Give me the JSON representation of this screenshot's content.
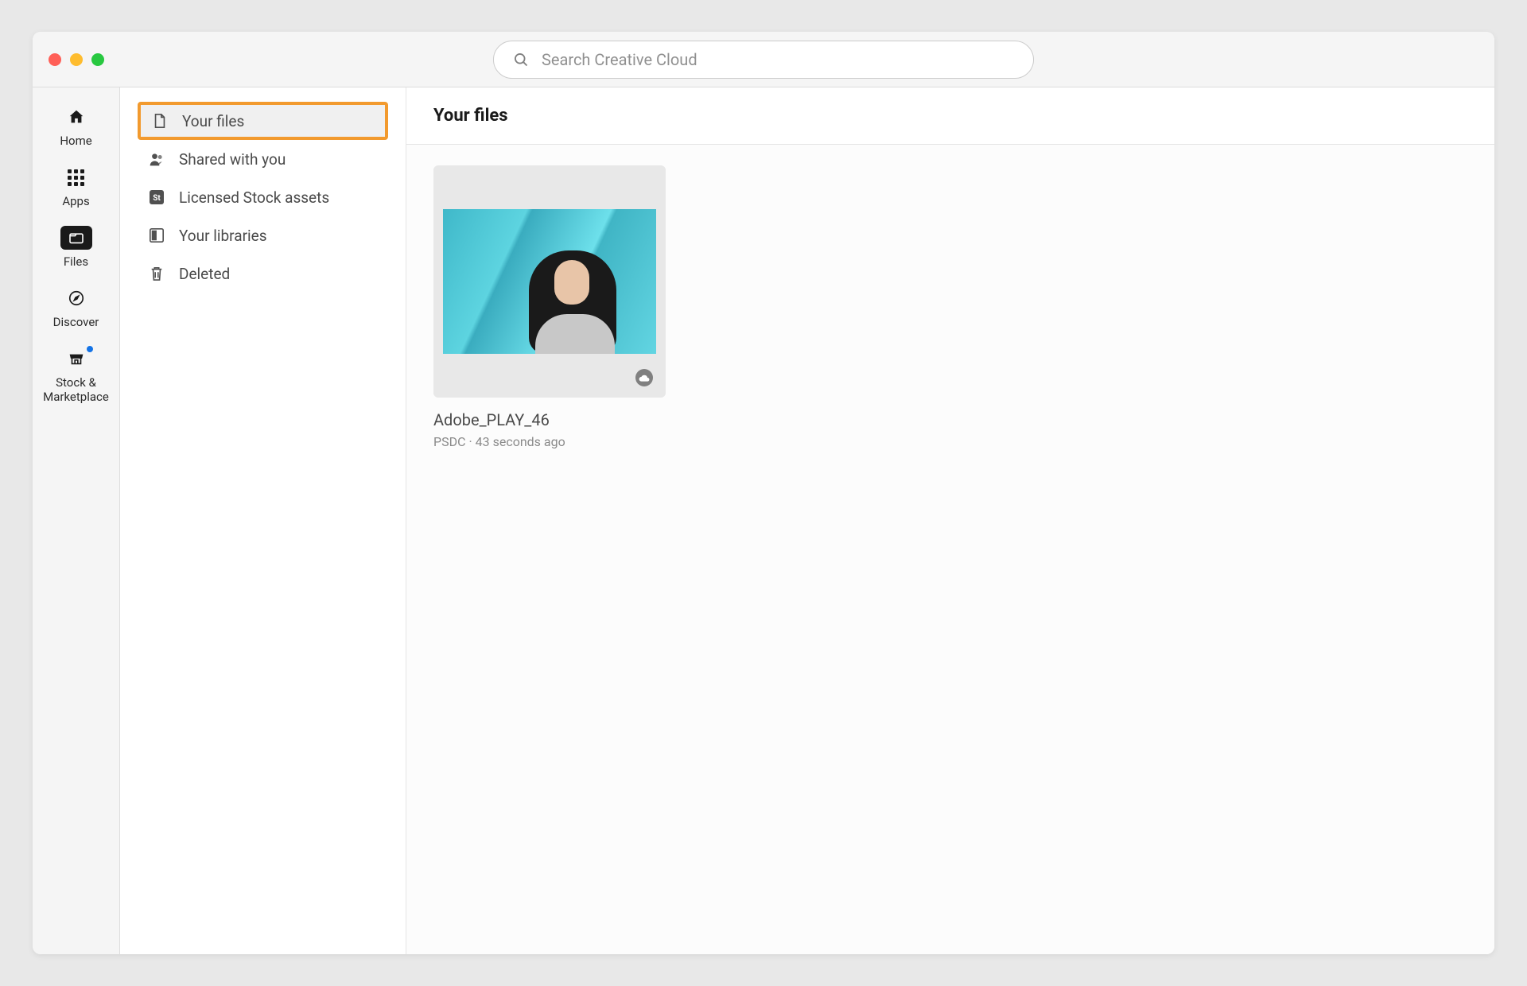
{
  "search": {
    "placeholder": "Search Creative Cloud"
  },
  "nav": {
    "items": [
      {
        "label": "Home"
      },
      {
        "label": "Apps"
      },
      {
        "label": "Files"
      },
      {
        "label": "Discover"
      },
      {
        "label": "Stock & Marketplace"
      }
    ]
  },
  "sidebar": {
    "items": [
      {
        "label": "Your files"
      },
      {
        "label": "Shared with you"
      },
      {
        "label": "Licensed Stock assets"
      },
      {
        "label": "Your libraries"
      },
      {
        "label": "Deleted"
      }
    ]
  },
  "content": {
    "title": "Your files"
  },
  "files": [
    {
      "name": "Adobe_PLAY_46",
      "meta": "PSDC · 43 seconds ago"
    }
  ]
}
